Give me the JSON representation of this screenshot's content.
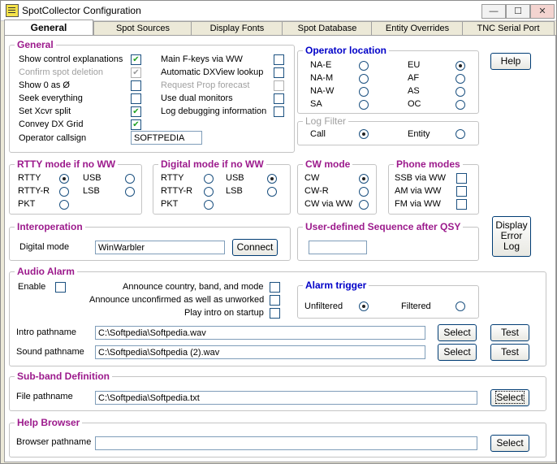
{
  "window": {
    "title": "SpotCollector Configuration",
    "minimize_glyph": "—",
    "maximize_glyph": "☐",
    "close_glyph": "✕"
  },
  "tabs": [
    "General",
    "Spot Sources",
    "Display Fonts",
    "Spot Database",
    "Entity Overrides",
    "TNC Serial Port"
  ],
  "general": {
    "title": "General",
    "checks": [
      {
        "label": "Show control explanations",
        "checked": true,
        "disabled": false
      },
      {
        "label": "Confirm spot deletion",
        "checked": true,
        "disabled": true
      },
      {
        "label": "Show 0 as Ø",
        "checked": false,
        "disabled": false
      },
      {
        "label": "Seek everything",
        "checked": false,
        "disabled": false
      },
      {
        "label": "Set Xcvr split",
        "checked": true,
        "disabled": false
      },
      {
        "label": "Convey DX Grid",
        "checked": true,
        "disabled": false
      }
    ],
    "checks_right": [
      {
        "label": "Main F-keys via WW",
        "checked": false,
        "disabled": false
      },
      {
        "label": "Automatic DXView lookup",
        "checked": false,
        "disabled": false
      },
      {
        "label": "Request Prop forecast",
        "checked": false,
        "disabled": true
      },
      {
        "label": "Use dual monitors",
        "checked": false,
        "disabled": false
      },
      {
        "label": "Log debugging information",
        "checked": false,
        "disabled": false
      }
    ],
    "callsign_label": "Operator callsign",
    "callsign_value": "SOFTPEDIA"
  },
  "operator_location": {
    "title": "Operator location",
    "options": [
      {
        "label": "NA-E",
        "selected": false
      },
      {
        "label": "NA-M",
        "selected": false
      },
      {
        "label": "NA-W",
        "selected": false
      },
      {
        "label": "SA",
        "selected": false
      },
      {
        "label": "EU",
        "selected": true
      },
      {
        "label": "AF",
        "selected": false
      },
      {
        "label": "AS",
        "selected": false
      },
      {
        "label": "OC",
        "selected": false
      }
    ]
  },
  "log_filter": {
    "title": "Log Filter",
    "options": [
      {
        "label": "Call",
        "selected": true
      },
      {
        "label": "Entity",
        "selected": false
      }
    ]
  },
  "help_button": "Help",
  "rtty": {
    "title": "RTTY mode if no WW",
    "options": [
      {
        "label": "RTTY",
        "selected": true
      },
      {
        "label": "RTTY-R",
        "selected": false
      },
      {
        "label": "PKT",
        "selected": false
      },
      {
        "label": "USB",
        "selected": false
      },
      {
        "label": "LSB",
        "selected": false
      }
    ]
  },
  "digital": {
    "title": "Digital mode if no WW",
    "options": [
      {
        "label": "RTTY",
        "selected": false
      },
      {
        "label": "RTTY-R",
        "selected": false
      },
      {
        "label": "PKT",
        "selected": false
      },
      {
        "label": "USB",
        "selected": true
      },
      {
        "label": "LSB",
        "selected": false
      }
    ]
  },
  "cw": {
    "title": "CW mode",
    "options": [
      {
        "label": "CW",
        "selected": true
      },
      {
        "label": "CW-R",
        "selected": false
      },
      {
        "label": "CW via WW",
        "selected": false
      }
    ]
  },
  "phone": {
    "title": "Phone modes",
    "options": [
      {
        "label": "SSB via WW",
        "checked": false
      },
      {
        "label": "AM via WW",
        "checked": false
      },
      {
        "label": "FM via WW",
        "checked": false
      }
    ]
  },
  "interop": {
    "title": "Interoperation",
    "label": "Digital mode",
    "value": "WinWarbler",
    "button": "Connect"
  },
  "user_seq": {
    "title": "User-defined Sequence after QSY",
    "value": ""
  },
  "display_error_log": [
    "Display",
    "Error",
    "Log"
  ],
  "audio": {
    "title": "Audio Alarm",
    "enable_label": "Enable",
    "enable_checked": false,
    "options": [
      {
        "label": "Announce country, band, and mode",
        "checked": false
      },
      {
        "label": "Announce unconfirmed as well as unworked",
        "checked": false
      },
      {
        "label": "Play intro on startup",
        "checked": false
      }
    ],
    "trigger_title": "Alarm trigger",
    "trigger_options": [
      {
        "label": "Unfiltered",
        "selected": true
      },
      {
        "label": "Filtered",
        "selected": false
      }
    ],
    "intro_label": "Intro pathname",
    "intro_value": "C:\\Softpedia\\Softpedia.wav",
    "sound_label": "Sound pathname",
    "sound_value": "C:\\Softpedia\\Softpedia (2).wav",
    "select_label": "Select",
    "test_label": "Test"
  },
  "subband": {
    "title": "Sub-band Definition",
    "label": "File pathname",
    "value": "C:\\Softpedia\\Softpedia.txt",
    "button": "Select"
  },
  "help_browser": {
    "title": "Help Browser",
    "label": "Browser pathname",
    "value": "",
    "button": "Select"
  },
  "colors": {
    "group_title": "#9c1a8c",
    "group_title_blue": "#0000c8",
    "check_mark": "#21a121"
  }
}
